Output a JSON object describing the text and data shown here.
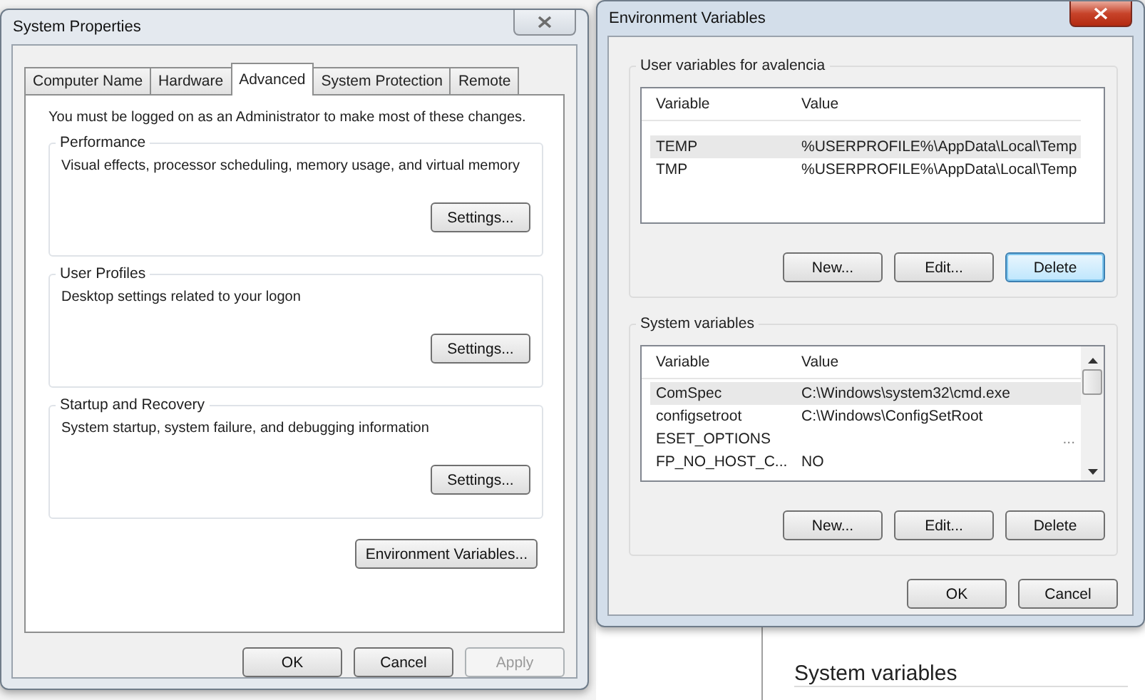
{
  "background": {
    "section_title": "System variables"
  },
  "system_properties": {
    "title": "System Properties",
    "active": false,
    "tabs": [
      {
        "label": "Computer Name",
        "selected": false
      },
      {
        "label": "Hardware",
        "selected": false
      },
      {
        "label": "Advanced",
        "selected": true
      },
      {
        "label": "System Protection",
        "selected": false
      },
      {
        "label": "Remote",
        "selected": false
      }
    ],
    "notice": "You must be logged on as an Administrator to make most of these changes.",
    "groups": [
      {
        "title": "Performance",
        "description": "Visual effects, processor scheduling, memory usage, and virtual memory",
        "button": "Settings..."
      },
      {
        "title": "User Profiles",
        "description": "Desktop settings related to your logon",
        "button": "Settings..."
      },
      {
        "title": "Startup and Recovery",
        "description": "System startup, system failure, and debugging information",
        "button": "Settings..."
      }
    ],
    "env_button": "Environment Variables...",
    "buttons": [
      {
        "label": "OK",
        "disabled": false
      },
      {
        "label": "Cancel",
        "disabled": false
      },
      {
        "label": "Apply",
        "disabled": true
      }
    ]
  },
  "environment_variables": {
    "title": "Environment Variables",
    "active": true,
    "sections": [
      {
        "title": "User variables for avalencia",
        "columns": [
          "Variable",
          "Value"
        ],
        "scrollbar": false,
        "rows": [
          {
            "variable": "TEMP",
            "value": "%USERPROFILE%\\AppData\\Local\\Temp",
            "selected": true
          },
          {
            "variable": "TMP",
            "value": "%USERPROFILE%\\AppData\\Local\\Temp",
            "selected": false
          }
        ],
        "buttons": [
          {
            "label": "New...",
            "focused": false
          },
          {
            "label": "Edit...",
            "focused": false
          },
          {
            "label": "Delete",
            "focused": true
          }
        ]
      },
      {
        "title": "System variables",
        "columns": [
          "Variable",
          "Value"
        ],
        "scrollbar": true,
        "rows": [
          {
            "variable": "ComSpec",
            "value": "C:\\Windows\\system32\\cmd.exe",
            "selected": true
          },
          {
            "variable": "configsetroot",
            "value": "C:\\Windows\\ConfigSetRoot",
            "selected": false
          },
          {
            "variable": "ESET_OPTIONS",
            "marker": "...",
            "selected": false
          },
          {
            "variable": "FP_NO_HOST_C...",
            "value": "NO",
            "selected": false
          }
        ],
        "buttons": [
          {
            "label": "New...",
            "focused": false
          },
          {
            "label": "Edit...",
            "focused": false
          },
          {
            "label": "Delete",
            "focused": false
          }
        ]
      }
    ],
    "buttons": [
      {
        "label": "OK",
        "focused": false
      },
      {
        "label": "Cancel",
        "focused": false
      }
    ]
  }
}
